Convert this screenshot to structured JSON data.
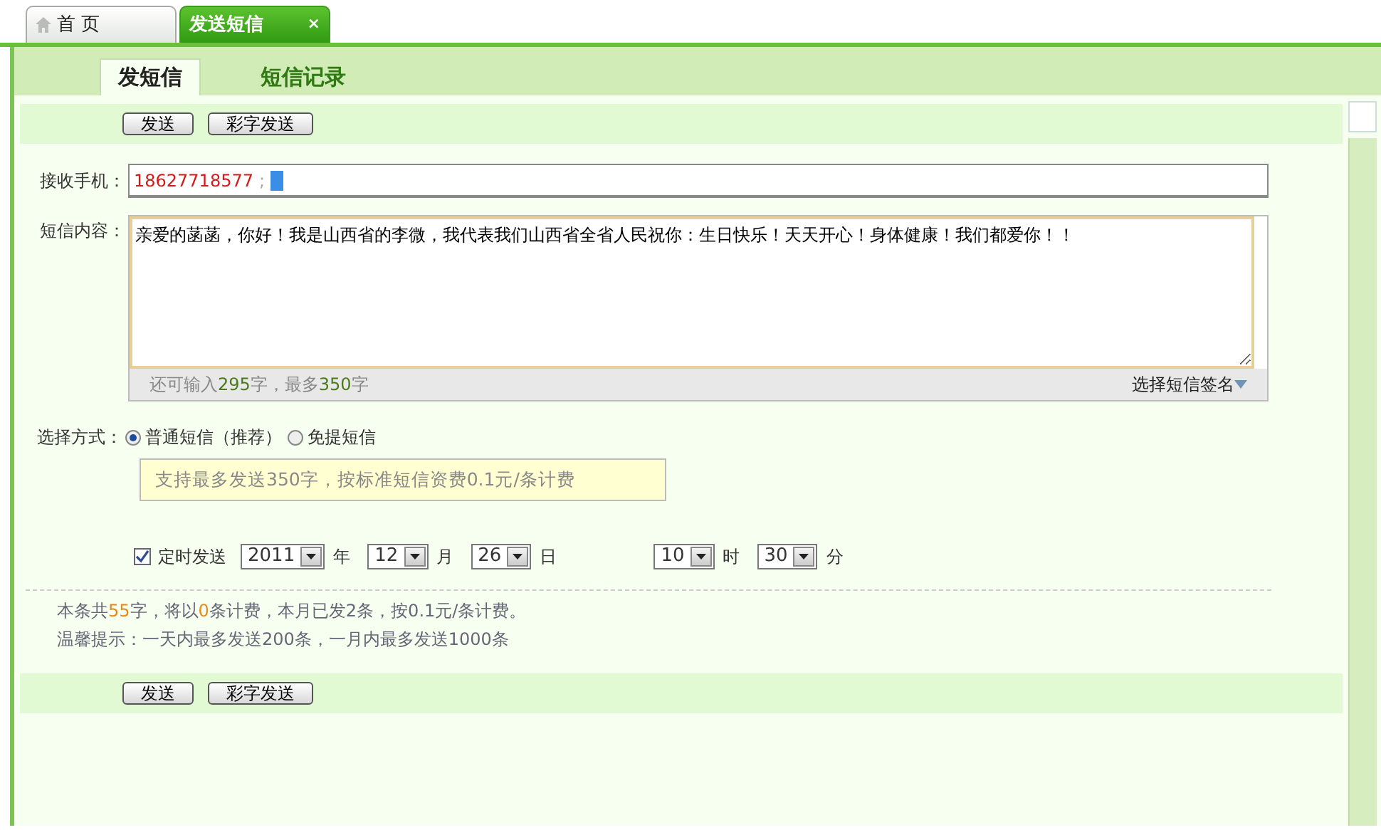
{
  "top_tabs": [
    {
      "label": "首 页",
      "selected": false
    },
    {
      "label": "发送短信",
      "selected": true,
      "close": "×"
    }
  ],
  "sub_tabs": [
    {
      "label": "发短信",
      "selected": true
    },
    {
      "label": "短信记录",
      "selected": false
    }
  ],
  "toolbar_top": [
    "发送",
    "彩字发送"
  ],
  "recipient": {
    "label": "接收手机：",
    "number": "18627718577",
    "separator": ";"
  },
  "content": {
    "label": "短信内容：",
    "value": "亲爱的菡菡，你好！我是山西省的李微，我代表我们山西省全省人民祝你：生日快乐！天天开心！身体健康！我们都爱你！！",
    "counter": {
      "prefix": "还可输入",
      "remaining": "295",
      "middle": "字，最多",
      "max": "350",
      "suffix": "字"
    },
    "signature_button": "选择短信签名"
  },
  "method": {
    "label": "选择方式：",
    "options": [
      {
        "label": "普通短信（推荐）",
        "selected": true
      },
      {
        "label": "免提短信",
        "selected": false
      }
    ],
    "hint": "支持最多发送350字，按标准短信资费0.1元/条计费"
  },
  "schedule": {
    "label": "定时发送",
    "checked": true,
    "fields": [
      {
        "value": "2011",
        "unit": "年"
      },
      {
        "value": "12",
        "unit": "月"
      },
      {
        "value": "26",
        "unit": "日"
      },
      {
        "value": "10",
        "unit": "时"
      },
      {
        "value": "30",
        "unit": "分"
      }
    ]
  },
  "summary": [
    {
      "text": "本条共",
      "highlight": false
    },
    {
      "text": "55",
      "highlight": true
    },
    {
      "text": "字，将以",
      "highlight": false
    },
    {
      "text": "0",
      "highlight": true
    },
    {
      "text": "条计费，本月已发2条，按0.1元/条计费。",
      "highlight": false
    }
  ],
  "tip": "温馨提示：一天内最多发送200条，一月内最多发送1000条",
  "toolbar_bottom": [
    "发送",
    "彩字发送"
  ]
}
